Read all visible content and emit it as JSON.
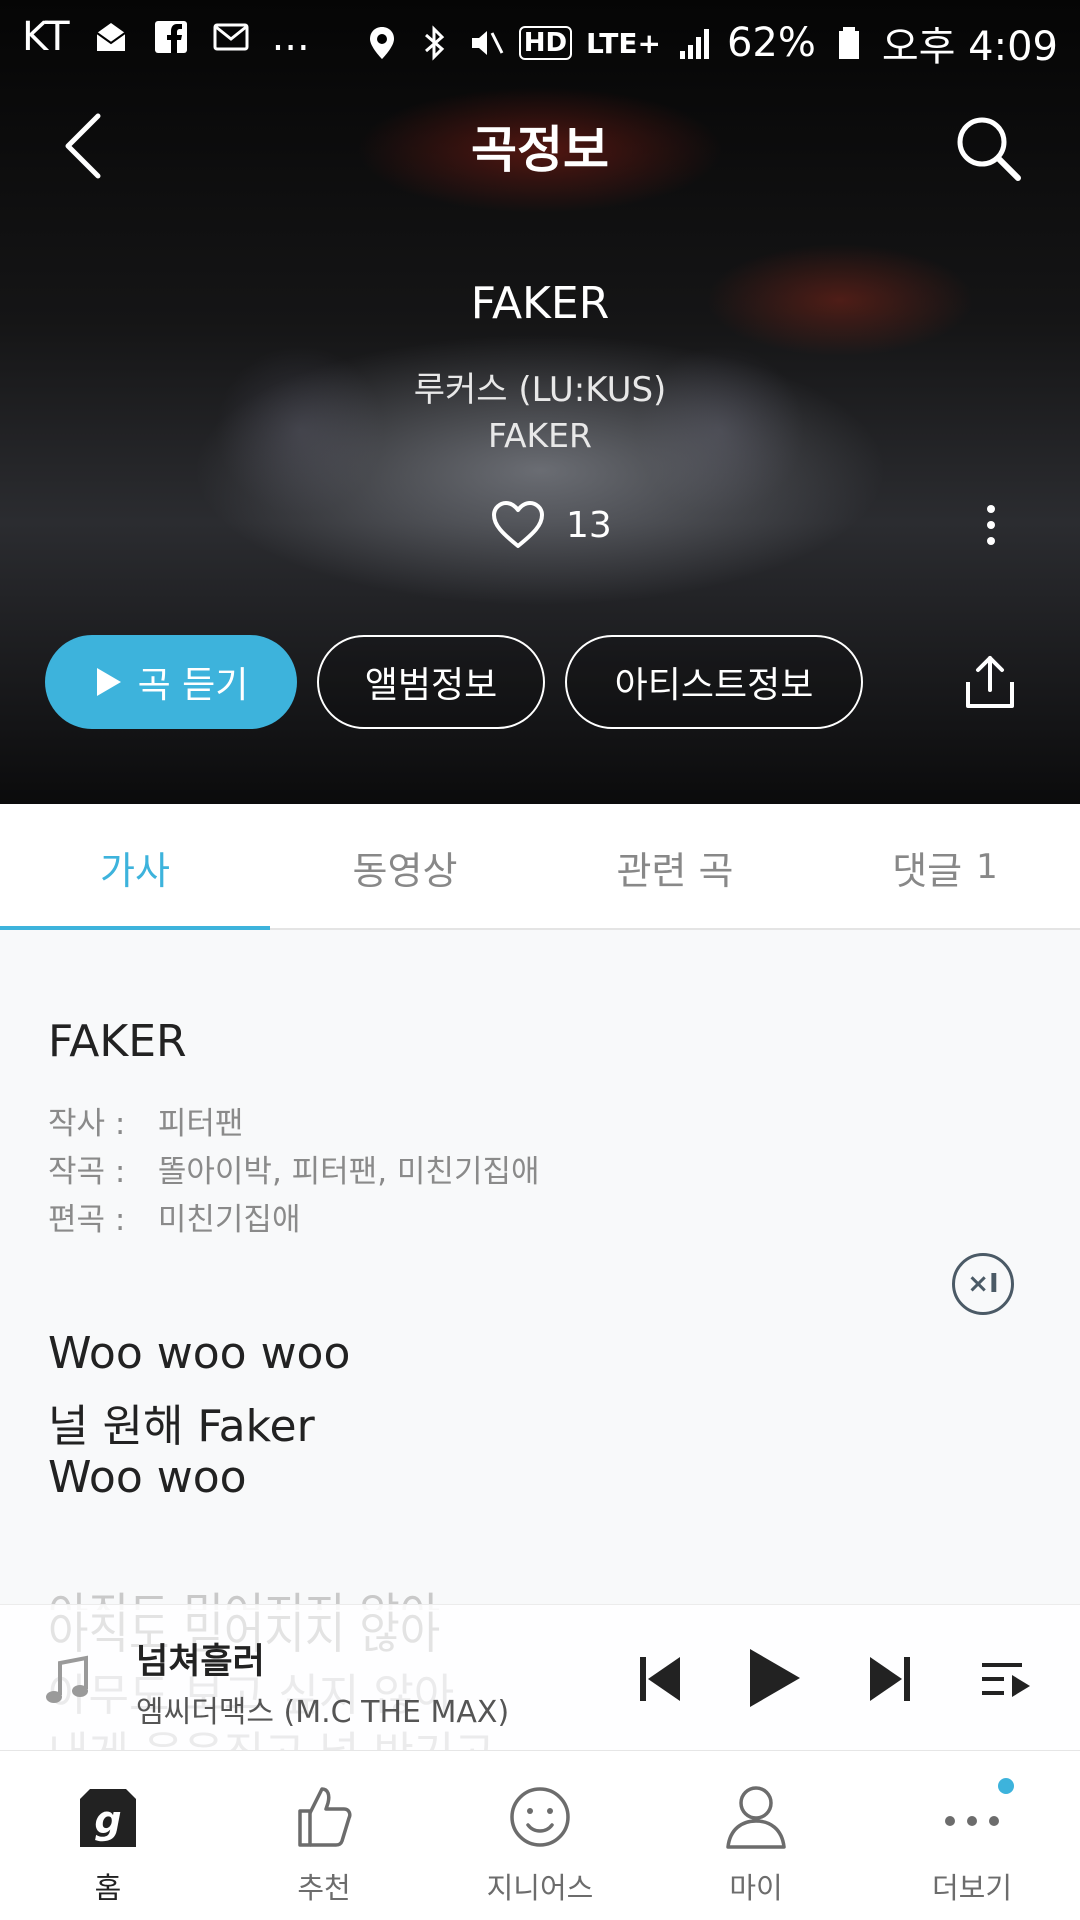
{
  "status_bar": {
    "carrier": "KT",
    "overflow": "...",
    "network": "LTE+",
    "hd": "HD",
    "battery": "62%",
    "time": "오후 4:09"
  },
  "header": {
    "title": "곡정보"
  },
  "song": {
    "title": "FAKER",
    "artist": "루커스 (LU:KUS)",
    "album": "FAKER",
    "likes": "13"
  },
  "actions": {
    "listen": "곡 듣기",
    "album_info": "앨범정보",
    "artist_info": "아티스트정보"
  },
  "tabs": [
    {
      "label": "가사",
      "active": true
    },
    {
      "label": "동영상"
    },
    {
      "label": "관련 곡"
    },
    {
      "label": "댓글",
      "count": "1"
    }
  ],
  "lyrics": {
    "title": "FAKER",
    "credits": [
      {
        "key": "작사 :",
        "value": "피터팬"
      },
      {
        "key": "작곡 :",
        "value": "똘아이박, 피터팬, 미친기집애"
      },
      {
        "key": "편곡 :",
        "value": "미친기집애"
      }
    ],
    "close_label": "×I",
    "lines": [
      "Woo woo woo",
      "널 원해 Faker",
      "Woo woo"
    ],
    "faded_lines": [
      "아직도 믿어지지 않아",
      "아무도 보고 싶지 않아",
      "내게 웃음짓고 널 반기고"
    ]
  },
  "mini_player": {
    "title": "넘쳐흘러",
    "artist": "엠씨더맥스 (M.C THE MAX)"
  },
  "bottom_nav": [
    {
      "label": "홈",
      "icon": "genie-home-icon"
    },
    {
      "label": "추천",
      "icon": "thumbs-up-icon"
    },
    {
      "label": "지니어스",
      "icon": "smile-icon"
    },
    {
      "label": "마이",
      "icon": "person-icon"
    },
    {
      "label": "더보기",
      "icon": "more-dots-icon"
    }
  ],
  "colors": {
    "accent": "#3db3dc",
    "hero_bg": "#111111",
    "content_bg": "#f8f9fa"
  }
}
